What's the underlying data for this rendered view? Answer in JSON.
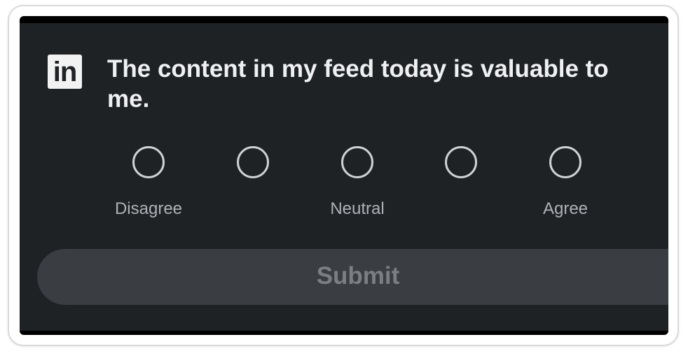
{
  "brand": {
    "logo_text": "in"
  },
  "survey": {
    "question": "The content in my feed today is valuable to me.",
    "options": [
      {
        "id": "strongly-disagree",
        "selected": false
      },
      {
        "id": "disagree",
        "selected": false
      },
      {
        "id": "neutral",
        "selected": false
      },
      {
        "id": "agree",
        "selected": false
      },
      {
        "id": "strongly-agree",
        "selected": false
      }
    ],
    "labels": {
      "left": "Disagree",
      "middle": "Neutral",
      "right": "Agree"
    },
    "submit_label": "Submit",
    "submit_enabled": false
  },
  "colors": {
    "card_background": "#1f2225",
    "text_primary": "#eef0f2",
    "text_muted": "#aeb2b6",
    "button_background": "#3a3d41",
    "button_text_disabled": "#7b7f84"
  }
}
